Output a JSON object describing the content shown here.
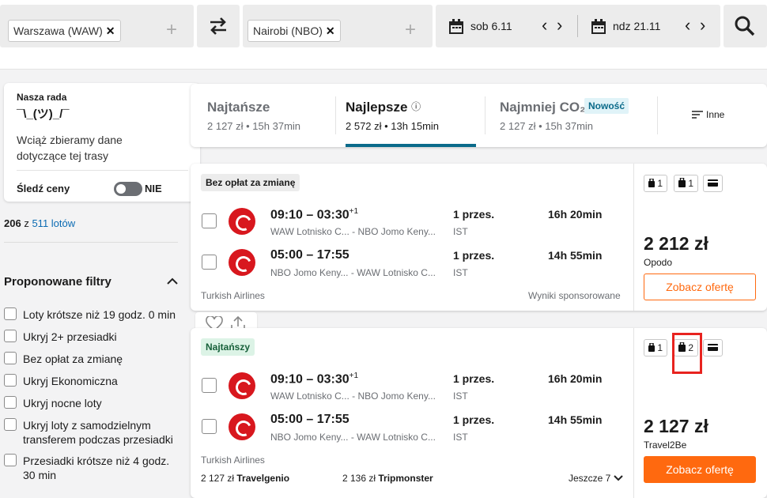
{
  "search": {
    "origin": "Warszawa (WAW)",
    "destination": "Nairobi (NBO)",
    "remove_symbol": "✕",
    "add_symbol": "+",
    "depart_date": "sob 6.11",
    "return_date": "ndz 21.11",
    "prev_symbol": "‹",
    "next_symbol": "›"
  },
  "advice": {
    "heading": "Nasza rada",
    "shrug": "¯\\_(ツ)_/¯",
    "text": "Wciąż zbieramy dane dotyczące tej trasy",
    "track_label": "Śledź ceny",
    "toggle_state": "NIE"
  },
  "results_count": {
    "shown": "206",
    "of": "z",
    "total": "511 lotów"
  },
  "filters": {
    "heading": "Proponowane filtry",
    "items": [
      "Loty krótsze niż 19 godz. 0 min",
      "Ukryj 2+ przesiadki",
      "Bez opłat za zmianę",
      "Ukryj Ekonomiczna",
      "Ukryj nocne loty",
      "Ukryj loty z samodzielnym transferem podczas przesiadki",
      "Przesiadki krótsze niż 4 godz. 30 min"
    ]
  },
  "sort_tabs": [
    {
      "title": "Najtańsze",
      "sub": "2 127 zł • 15h 37min"
    },
    {
      "title": "Najlepsze",
      "sub": "2 572 zł • 13h 15min",
      "info": "ⓘ"
    },
    {
      "title": "Najmniej CO₂",
      "sub": "2 127 zł • 15h 37min",
      "badge": "Nowość"
    }
  ],
  "more_label": "Inne",
  "results": [
    {
      "tag": "Bez opłat za zmianę",
      "legs": [
        {
          "times": "09:10 – 03:30",
          "plus": "+1",
          "airports": "WAW Lotnisko C... - NBO Jomo Keny...",
          "stops": "1 przes.",
          "stop_code": "IST",
          "duration": "16h 20min"
        },
        {
          "times": "05:00 – 17:55",
          "plus": "",
          "airports": "NBO Jomo Keny... - WAW Lotnisko C...",
          "stops": "1 przes.",
          "stop_code": "IST",
          "duration": "14h 55min"
        }
      ],
      "airline": "Turkish Airlines",
      "note": "Wyniki sponsorowane",
      "bags": {
        "personal": "1",
        "carry": "1"
      },
      "price": "2 212 zł",
      "provider": "Opodo",
      "cta": "Zobacz ofertę"
    },
    {
      "tag": "Najtańszy",
      "legs": [
        {
          "times": "09:10 – 03:30",
          "plus": "+1",
          "airports": "WAW Lotnisko C... - NBO Jomo Keny...",
          "stops": "1 przes.",
          "stop_code": "IST",
          "duration": "16h 20min"
        },
        {
          "times": "05:00 – 17:55",
          "plus": "",
          "airports": "NBO Jomo Keny... - WAW Lotnisko C...",
          "stops": "1 przes.",
          "stop_code": "IST",
          "duration": "14h 55min"
        }
      ],
      "airline": "Turkish Airlines",
      "bags": {
        "personal": "1",
        "carry": "2"
      },
      "price": "2 127 zł",
      "provider": "Travel2Be",
      "cta": "Zobacz ofertę",
      "alt_offers": [
        {
          "price": "2 127 zł",
          "name": "Travelgenio"
        },
        {
          "price": "2 136 zł",
          "name": "Tripmonster"
        }
      ],
      "more": "Jeszcze 7"
    }
  ],
  "colors": {
    "accent": "#ff690f",
    "link": "#0b6bb3",
    "tab_underline": "#0a6a8a",
    "highlight": "#e8231f"
  }
}
